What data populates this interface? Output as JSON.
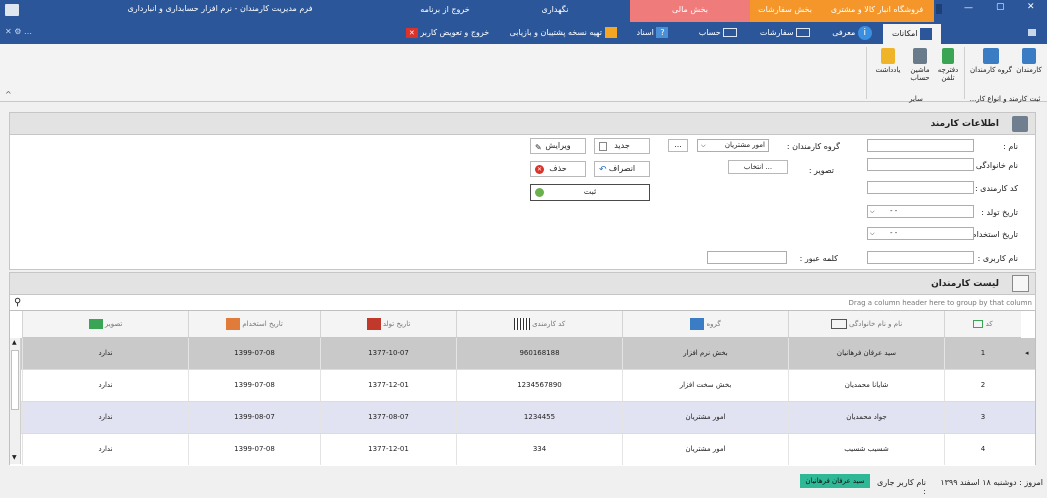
{
  "window": {
    "title": "فرم مدیریت کارمندان - نرم افزار حسابداری و انبارداری",
    "minimize": "—",
    "maximize": "▢",
    "close": "✕"
  },
  "title_tabs": {
    "exit_app": "خروج از برنامه",
    "maintenance": "نگهداری",
    "finance": "بخش مالی",
    "orders": "بخش سفارشات",
    "store": "فروشگاه انبار کالا و مشتری"
  },
  "ribbon_tabs": {
    "facilities": "امکانات",
    "intro": "معرفی",
    "orders": "سفارشات",
    "account": "حساب",
    "documents": "اسناد",
    "backup": "تهیه نسخه پشتیبان و بازیابی",
    "exit_change_user": "خروج و تعویض کاربر"
  },
  "ribbon": {
    "group1": {
      "employees": "کارمندان",
      "employee_groups": "گروه کارمندان",
      "caption": "ثبت کارمند و انواع کار..."
    },
    "group2": {
      "phonebook": "دفترچه تلفن",
      "calculator": "ماشین حساب",
      "note": "یادداشت",
      "caption": "سایر"
    },
    "collapse": "^"
  },
  "info_panel": {
    "title": "اطلاعات کارمند",
    "labels": {
      "first_name": "نام :",
      "last_name": "نام خانوادگی :",
      "employee_code": "کد کارمندی :",
      "birth_date": "تاریخ تولد :",
      "hire_date": "تاریخ استخدام :",
      "username": "نام کاربری :",
      "password": "کلمه عبور :",
      "employee_group": "گروه کارمندان :",
      "photo": "تصویر :"
    },
    "group_value": "امور مشتریان",
    "date_placeholder": "-  -",
    "browse_button": "انتخاب ...",
    "dots_button": "...",
    "buttons": {
      "new": "جدید",
      "edit": "ویرایش",
      "cancel": "انصراف",
      "delete": "حذف",
      "submit": "ثبت"
    }
  },
  "list_panel": {
    "title": "لیست کارمندان",
    "group_hint": "Drag a column header here to group by that column",
    "columns": [
      "کد",
      "نام و نام خانوادگی",
      "گروه",
      "کد کارمندی",
      "تاریخ تولد",
      "تاریخ استخدام",
      "تصویر"
    ],
    "rows": [
      {
        "id": "1",
        "name": "سید عرفان فرهانیان",
        "group": "بخش نرم افزار",
        "code": "960168188",
        "birth": "1377-10-07",
        "hire": "1399-07-08",
        "photo": "ندارد"
      },
      {
        "id": "2",
        "name": "شایانا محمدیان",
        "group": "بخش سخت افزار",
        "code": "1234567890",
        "birth": "1377-12-01",
        "hire": "1399-07-08",
        "photo": "ندارد"
      },
      {
        "id": "3",
        "name": "جواد محمدیان",
        "group": "امور مشتریان",
        "code": "1234455",
        "birth": "1377-08-07",
        "hire": "1399-08-07",
        "photo": "ندارد"
      },
      {
        "id": "4",
        "name": "شسیب شسیب",
        "group": "امور مشتریان",
        "code": "334",
        "birth": "1377-12-01",
        "hire": "1399-07-08",
        "photo": "ندارد"
      }
    ]
  },
  "status_bar": {
    "today": "امروز : دوشنبه ۱۸ اسفند ۱۳۹۹",
    "current_user_label": "نام کاربر جاری :",
    "current_user": "سید عرفان فرهانیان"
  },
  "colors": {
    "title_blue": "#2b579a",
    "finance_tab": "#f07b7b",
    "orders_tab": "#f5962b",
    "store_tab": "#f5962b",
    "selected_row": "#c9c9c9",
    "alt_row": "#e2e3f2",
    "user_badge": "#2eb895"
  }
}
